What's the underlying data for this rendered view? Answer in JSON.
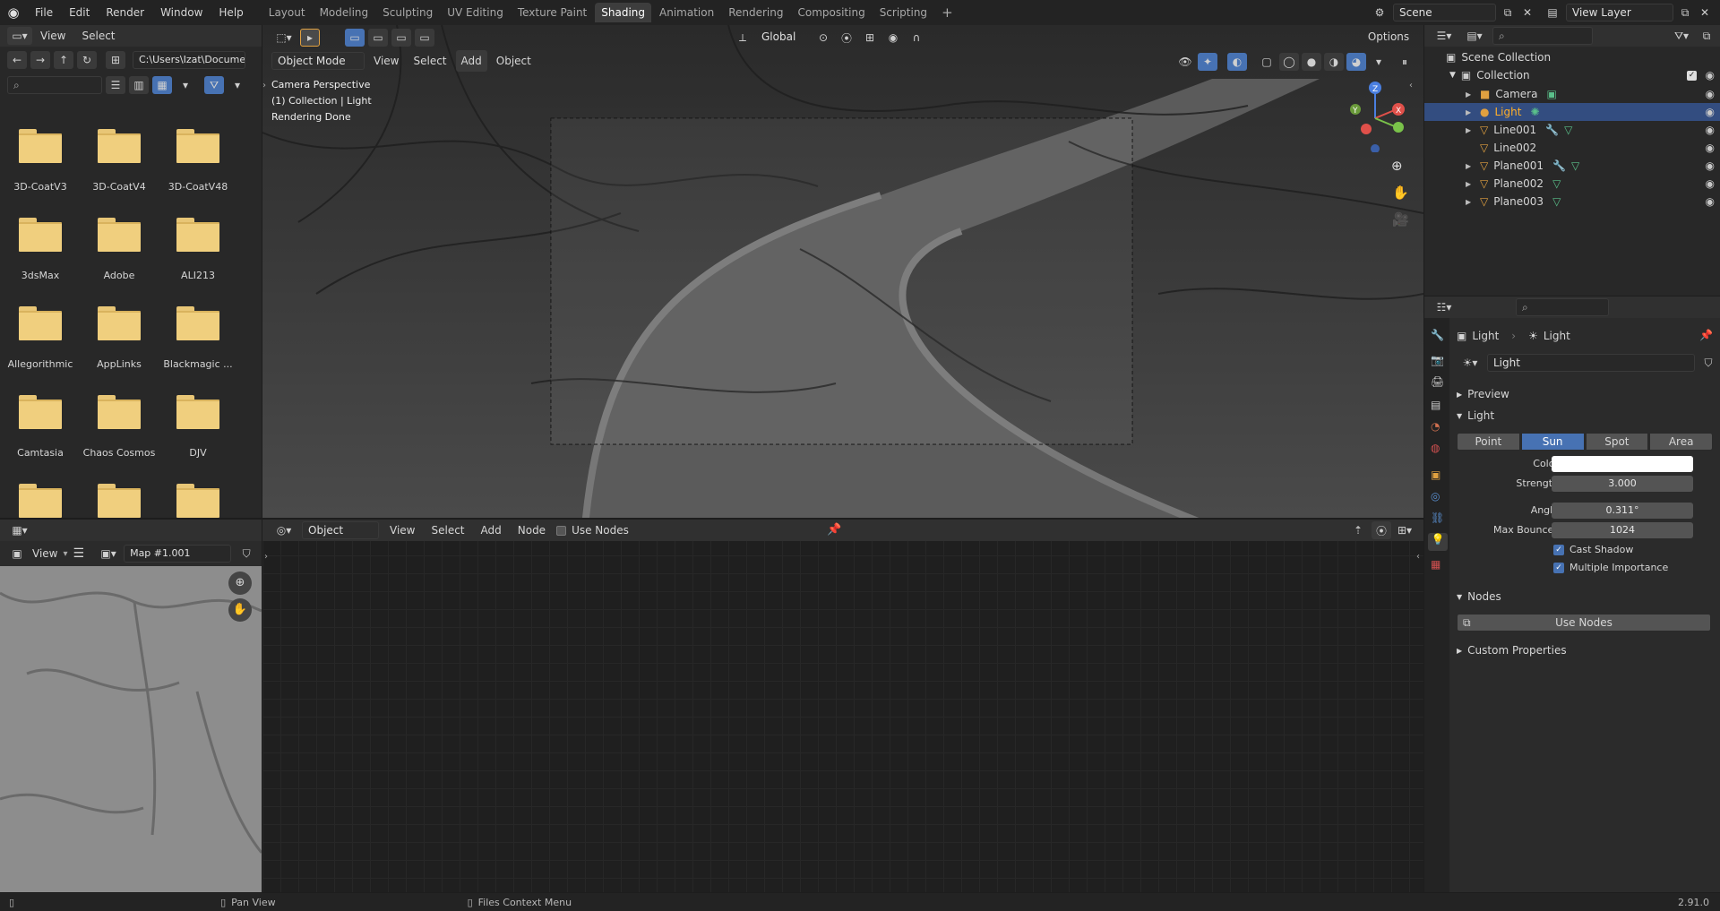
{
  "topbar": {
    "menus": [
      "File",
      "Edit",
      "Render",
      "Window",
      "Help"
    ],
    "workspaces": [
      "Layout",
      "Modeling",
      "Sculpting",
      "UV Editing",
      "Texture Paint",
      "Shading",
      "Animation",
      "Rendering",
      "Compositing",
      "Scripting"
    ],
    "active_workspace": "Shading",
    "add_tab": "+",
    "scene": "Scene",
    "view_layer": "View Layer"
  },
  "filebrowser": {
    "menus": [
      "View",
      "Select"
    ],
    "path": "C:\\Users\\Izat\\Docume...",
    "folders": [
      "3D-CoatV3",
      "3D-CoatV4",
      "3D-CoatV48",
      "3dsMax",
      "Adobe",
      "ALI213",
      "Allegorithmic",
      "AppLinks",
      "Blackmagic ...",
      "Camtasia",
      "Chaos Cosmos",
      "DJV",
      "",
      "",
      ""
    ]
  },
  "viewport": {
    "mode": "Object Mode",
    "menus": [
      "View",
      "Select",
      "Add",
      "Object"
    ],
    "transform": "Global",
    "options": "Options",
    "overlay_lines": [
      "Camera Perspective",
      "(1) Collection | Light",
      "Rendering Done"
    ],
    "gizmo": {
      "x": "X",
      "y": "Y",
      "z": "Z"
    }
  },
  "nodeeditor": {
    "type": "Object",
    "menus": [
      "View",
      "Select",
      "Add",
      "Node"
    ],
    "use_nodes": "Use Nodes"
  },
  "imageeditor": {
    "view": "View",
    "image_name": "Map #1.001"
  },
  "outliner": {
    "root": "Scene Collection",
    "collection": "Collection",
    "items": [
      {
        "name": "Camera",
        "color": "#e0a040"
      },
      {
        "name": "Light",
        "color": "#e0a040"
      },
      {
        "name": "Line001",
        "color": "#e0a040"
      },
      {
        "name": "Line002",
        "color": "#e0a040"
      },
      {
        "name": "Plane001",
        "color": "#e0a040"
      },
      {
        "name": "Plane002",
        "color": "#e0a040"
      },
      {
        "name": "Plane003",
        "color": "#e0a040"
      }
    ]
  },
  "properties": {
    "breadcrumb_obj": "Light",
    "breadcrumb_data": "Light",
    "datablock": "Light",
    "preview": "Preview",
    "light_panel": "Light",
    "types": [
      "Point",
      "Sun",
      "Spot",
      "Area"
    ],
    "active_type": "Sun",
    "color_label": "Color",
    "strength_label": "Strength",
    "strength": "3.000",
    "angle_label": "Angle",
    "angle": "0.311°",
    "bounces_label": "Max Bounces",
    "bounces": "1024",
    "cast_shadow": "Cast Shadow",
    "multiple_importance": "Multiple Importance",
    "nodes_panel": "Nodes",
    "use_nodes_btn": "Use Nodes",
    "custom_props": "Custom Properties"
  },
  "statusbar": {
    "pan": "Pan View",
    "context": "Files Context Menu",
    "version": "2.91.0"
  },
  "colors": {
    "accent": "#4772b3",
    "selected_row": "#334d80",
    "folder": "#f0cf7e",
    "object_orange": "#e0a040"
  }
}
